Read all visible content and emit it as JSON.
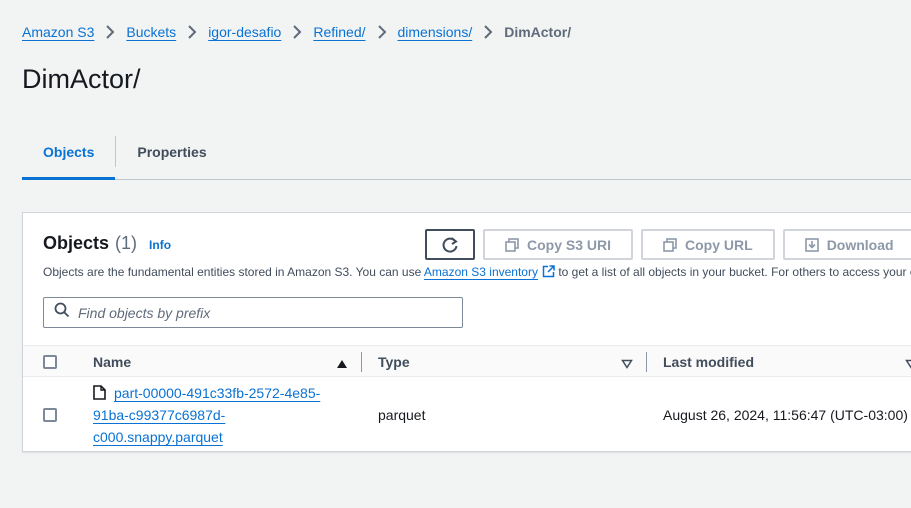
{
  "breadcrumb": {
    "items": [
      "Amazon S3",
      "Buckets",
      "igor-desafio",
      "Refined/",
      "dimensions/"
    ],
    "current": "DimActor/"
  },
  "page": {
    "title": "DimActor/"
  },
  "tabs": [
    {
      "label": "Objects",
      "active": true
    },
    {
      "label": "Properties",
      "active": false
    }
  ],
  "objects_panel": {
    "title": "Objects",
    "count": "(1)",
    "info_label": "Info",
    "buttons": {
      "copy_s3_uri": "Copy S3 URI",
      "copy_url": "Copy URL",
      "download": "Download"
    },
    "description_prefix": "Objects are the fundamental entities stored in Amazon S3. You can use ",
    "description_link": "Amazon S3 inventory",
    "description_suffix": " to get a list of all objects in your bucket. For others to access your objects, you'll need to explicitly grant them permissions.",
    "search_placeholder": "Find objects by prefix"
  },
  "table": {
    "columns": [
      "Name",
      "Type",
      "Last modified"
    ],
    "rows": [
      {
        "name_lines": [
          "part-00000-491c33fb-2572-4e85-",
          "91ba-c99377c6987d-",
          "c000.snappy.parquet"
        ],
        "type": "parquet",
        "last_modified": "August 26, 2024, 11:56:47 (UTC-03:00)"
      }
    ]
  },
  "colors": {
    "link": "#0972d3",
    "background": "#f2f3f3",
    "text": "#16191f",
    "disabled": "#8d99a8"
  },
  "icons": [
    "chevron-right-icon",
    "refresh-icon",
    "copy-icon",
    "download-icon",
    "external-link-icon",
    "search-icon",
    "sort-ascending-icon",
    "sort-descending-icon",
    "file-icon"
  ]
}
